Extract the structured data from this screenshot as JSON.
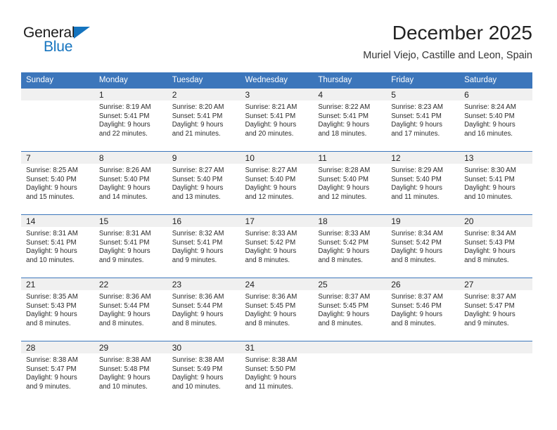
{
  "brand": {
    "word1": "General",
    "word2": "Blue",
    "triangle_color": "#1574bf",
    "icon": "triangle-logo-icon"
  },
  "header": {
    "title": "December 2025",
    "location": "Muriel Viejo, Castille and Leon, Spain",
    "header_bg": "#3c76bb",
    "daynum_bg": "#f0f0f0"
  },
  "weekdays": [
    "Sunday",
    "Monday",
    "Tuesday",
    "Wednesday",
    "Thursday",
    "Friday",
    "Saturday"
  ],
  "weeks": [
    [
      {
        "day": ""
      },
      {
        "day": "1",
        "sunrise": "Sunrise: 8:19 AM",
        "sunset": "Sunset: 5:41 PM",
        "daylight1": "Daylight: 9 hours",
        "daylight2": "and 22 minutes."
      },
      {
        "day": "2",
        "sunrise": "Sunrise: 8:20 AM",
        "sunset": "Sunset: 5:41 PM",
        "daylight1": "Daylight: 9 hours",
        "daylight2": "and 21 minutes."
      },
      {
        "day": "3",
        "sunrise": "Sunrise: 8:21 AM",
        "sunset": "Sunset: 5:41 PM",
        "daylight1": "Daylight: 9 hours",
        "daylight2": "and 20 minutes."
      },
      {
        "day": "4",
        "sunrise": "Sunrise: 8:22 AM",
        "sunset": "Sunset: 5:41 PM",
        "daylight1": "Daylight: 9 hours",
        "daylight2": "and 18 minutes."
      },
      {
        "day": "5",
        "sunrise": "Sunrise: 8:23 AM",
        "sunset": "Sunset: 5:41 PM",
        "daylight1": "Daylight: 9 hours",
        "daylight2": "and 17 minutes."
      },
      {
        "day": "6",
        "sunrise": "Sunrise: 8:24 AM",
        "sunset": "Sunset: 5:40 PM",
        "daylight1": "Daylight: 9 hours",
        "daylight2": "and 16 minutes."
      }
    ],
    [
      {
        "day": "7",
        "sunrise": "Sunrise: 8:25 AM",
        "sunset": "Sunset: 5:40 PM",
        "daylight1": "Daylight: 9 hours",
        "daylight2": "and 15 minutes."
      },
      {
        "day": "8",
        "sunrise": "Sunrise: 8:26 AM",
        "sunset": "Sunset: 5:40 PM",
        "daylight1": "Daylight: 9 hours",
        "daylight2": "and 14 minutes."
      },
      {
        "day": "9",
        "sunrise": "Sunrise: 8:27 AM",
        "sunset": "Sunset: 5:40 PM",
        "daylight1": "Daylight: 9 hours",
        "daylight2": "and 13 minutes."
      },
      {
        "day": "10",
        "sunrise": "Sunrise: 8:27 AM",
        "sunset": "Sunset: 5:40 PM",
        "daylight1": "Daylight: 9 hours",
        "daylight2": "and 12 minutes."
      },
      {
        "day": "11",
        "sunrise": "Sunrise: 8:28 AM",
        "sunset": "Sunset: 5:40 PM",
        "daylight1": "Daylight: 9 hours",
        "daylight2": "and 12 minutes."
      },
      {
        "day": "12",
        "sunrise": "Sunrise: 8:29 AM",
        "sunset": "Sunset: 5:40 PM",
        "daylight1": "Daylight: 9 hours",
        "daylight2": "and 11 minutes."
      },
      {
        "day": "13",
        "sunrise": "Sunrise: 8:30 AM",
        "sunset": "Sunset: 5:41 PM",
        "daylight1": "Daylight: 9 hours",
        "daylight2": "and 10 minutes."
      }
    ],
    [
      {
        "day": "14",
        "sunrise": "Sunrise: 8:31 AM",
        "sunset": "Sunset: 5:41 PM",
        "daylight1": "Daylight: 9 hours",
        "daylight2": "and 10 minutes."
      },
      {
        "day": "15",
        "sunrise": "Sunrise: 8:31 AM",
        "sunset": "Sunset: 5:41 PM",
        "daylight1": "Daylight: 9 hours",
        "daylight2": "and 9 minutes."
      },
      {
        "day": "16",
        "sunrise": "Sunrise: 8:32 AM",
        "sunset": "Sunset: 5:41 PM",
        "daylight1": "Daylight: 9 hours",
        "daylight2": "and 9 minutes."
      },
      {
        "day": "17",
        "sunrise": "Sunrise: 8:33 AM",
        "sunset": "Sunset: 5:42 PM",
        "daylight1": "Daylight: 9 hours",
        "daylight2": "and 8 minutes."
      },
      {
        "day": "18",
        "sunrise": "Sunrise: 8:33 AM",
        "sunset": "Sunset: 5:42 PM",
        "daylight1": "Daylight: 9 hours",
        "daylight2": "and 8 minutes."
      },
      {
        "day": "19",
        "sunrise": "Sunrise: 8:34 AM",
        "sunset": "Sunset: 5:42 PM",
        "daylight1": "Daylight: 9 hours",
        "daylight2": "and 8 minutes."
      },
      {
        "day": "20",
        "sunrise": "Sunrise: 8:34 AM",
        "sunset": "Sunset: 5:43 PM",
        "daylight1": "Daylight: 9 hours",
        "daylight2": "and 8 minutes."
      }
    ],
    [
      {
        "day": "21",
        "sunrise": "Sunrise: 8:35 AM",
        "sunset": "Sunset: 5:43 PM",
        "daylight1": "Daylight: 9 hours",
        "daylight2": "and 8 minutes."
      },
      {
        "day": "22",
        "sunrise": "Sunrise: 8:36 AM",
        "sunset": "Sunset: 5:44 PM",
        "daylight1": "Daylight: 9 hours",
        "daylight2": "and 8 minutes."
      },
      {
        "day": "23",
        "sunrise": "Sunrise: 8:36 AM",
        "sunset": "Sunset: 5:44 PM",
        "daylight1": "Daylight: 9 hours",
        "daylight2": "and 8 minutes."
      },
      {
        "day": "24",
        "sunrise": "Sunrise: 8:36 AM",
        "sunset": "Sunset: 5:45 PM",
        "daylight1": "Daylight: 9 hours",
        "daylight2": "and 8 minutes."
      },
      {
        "day": "25",
        "sunrise": "Sunrise: 8:37 AM",
        "sunset": "Sunset: 5:45 PM",
        "daylight1": "Daylight: 9 hours",
        "daylight2": "and 8 minutes."
      },
      {
        "day": "26",
        "sunrise": "Sunrise: 8:37 AM",
        "sunset": "Sunset: 5:46 PM",
        "daylight1": "Daylight: 9 hours",
        "daylight2": "and 8 minutes."
      },
      {
        "day": "27",
        "sunrise": "Sunrise: 8:37 AM",
        "sunset": "Sunset: 5:47 PM",
        "daylight1": "Daylight: 9 hours",
        "daylight2": "and 9 minutes."
      }
    ],
    [
      {
        "day": "28",
        "sunrise": "Sunrise: 8:38 AM",
        "sunset": "Sunset: 5:47 PM",
        "daylight1": "Daylight: 9 hours",
        "daylight2": "and 9 minutes."
      },
      {
        "day": "29",
        "sunrise": "Sunrise: 8:38 AM",
        "sunset": "Sunset: 5:48 PM",
        "daylight1": "Daylight: 9 hours",
        "daylight2": "and 10 minutes."
      },
      {
        "day": "30",
        "sunrise": "Sunrise: 8:38 AM",
        "sunset": "Sunset: 5:49 PM",
        "daylight1": "Daylight: 9 hours",
        "daylight2": "and 10 minutes."
      },
      {
        "day": "31",
        "sunrise": "Sunrise: 8:38 AM",
        "sunset": "Sunset: 5:50 PM",
        "daylight1": "Daylight: 9 hours",
        "daylight2": "and 11 minutes."
      },
      {
        "day": ""
      },
      {
        "day": ""
      },
      {
        "day": ""
      }
    ]
  ]
}
